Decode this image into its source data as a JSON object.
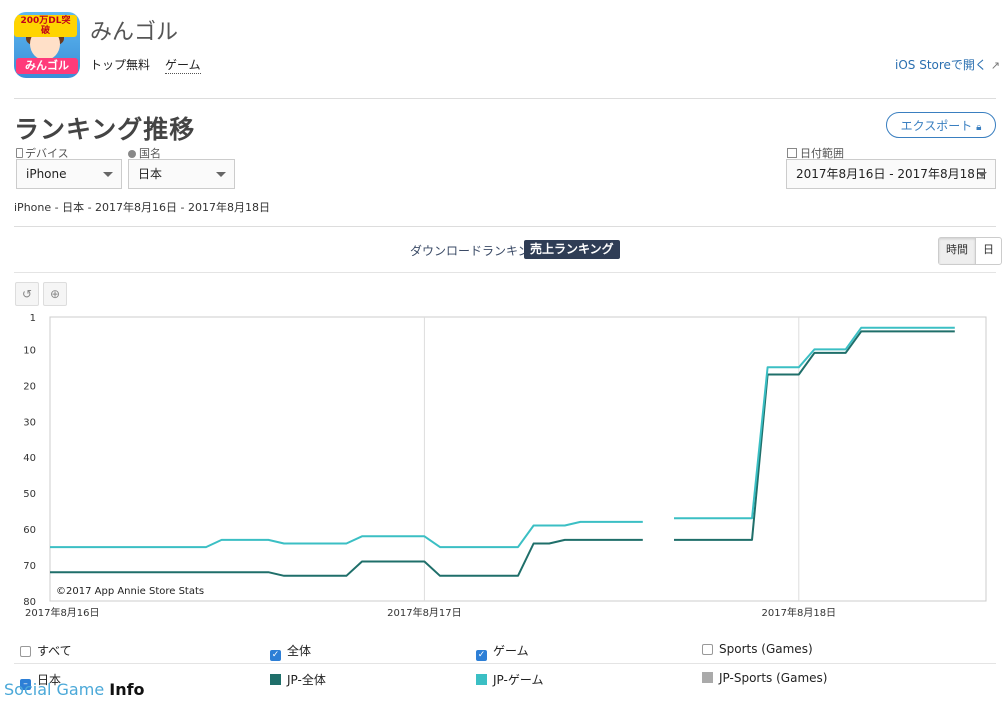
{
  "app": {
    "title": "みんゴル",
    "icon_badge": "200万DL突破",
    "icon_logo": "みんゴル",
    "category_primary": "トップ無料",
    "category_secondary": "ゲーム",
    "store_link": "iOS Storeで開く"
  },
  "section": {
    "title": "ランキング推移",
    "export_label": "エクスポート"
  },
  "filters": {
    "device_label": "デバイス",
    "device_value": "iPhone",
    "country_label": "国名",
    "country_value": "日本",
    "date_label": "日付範囲",
    "date_value": "2017年8月16日 - 2017年8月18日"
  },
  "summary": "iPhone - 日本 - 2017年8月16日 - 2017年8月18日",
  "tabs": {
    "download": "ダウンロードランキング",
    "revenue": "売上ランキング"
  },
  "granularity": {
    "hour": "時間",
    "day": "日"
  },
  "copyright": "©2017 App Annie Store Stats",
  "colors": {
    "series_all": "#1f6f6a",
    "series_game": "#3bbfc4",
    "series_sports": "#aaaaaa",
    "accent": "#2d7fd6"
  },
  "legend": {
    "filters": [
      {
        "label": "すべて",
        "checked": false
      },
      {
        "label": "全体",
        "checked": true
      },
      {
        "label": "ゲーム",
        "checked": true
      },
      {
        "label": "Sports (Games)",
        "checked": false
      }
    ],
    "country": "日本",
    "series": [
      {
        "label": "JP-全体"
      },
      {
        "label": "JP-ゲーム"
      },
      {
        "label": "JP-Sports (Games)"
      }
    ]
  },
  "watermark": {
    "text": "Social Game",
    "bold": "Info"
  },
  "chart_data": {
    "type": "line",
    "x_unit": "hours since 2017年8月16日 00:00",
    "xlim": [
      0,
      60
    ],
    "y_inverted": true,
    "ylim": [
      1,
      80
    ],
    "y_ticks": [
      1,
      10,
      20,
      30,
      40,
      50,
      60,
      70,
      80
    ],
    "x_ticks": [
      {
        "x": 0,
        "label": "2017年8月16日"
      },
      {
        "x": 24,
        "label": "2017年8月17日"
      },
      {
        "x": 48,
        "label": "2017年8月18日"
      }
    ],
    "grid": true,
    "series": [
      {
        "name": "JP-全体",
        "points": [
          [
            0,
            72
          ],
          [
            14,
            72
          ],
          [
            15,
            73
          ],
          [
            19,
            73
          ],
          [
            20,
            69
          ],
          [
            24,
            69
          ],
          [
            25,
            73
          ],
          [
            30,
            73
          ],
          [
            31,
            64
          ],
          [
            32,
            64
          ],
          [
            33,
            63
          ],
          [
            38,
            63
          ],
          null,
          [
            40,
            63
          ],
          [
            45,
            63
          ],
          [
            46,
            17
          ],
          [
            48,
            17
          ],
          [
            49,
            11
          ],
          [
            51,
            11
          ],
          [
            52,
            5
          ],
          [
            58,
            5
          ]
        ]
      },
      {
        "name": "JP-ゲーム",
        "points": [
          [
            0,
            65
          ],
          [
            10,
            65
          ],
          [
            11,
            63
          ],
          [
            14,
            63
          ],
          [
            15,
            64
          ],
          [
            19,
            64
          ],
          [
            20,
            62
          ],
          [
            24,
            62
          ],
          [
            25,
            65
          ],
          [
            30,
            65
          ],
          [
            31,
            59
          ],
          [
            33,
            59
          ],
          [
            34,
            58
          ],
          [
            38,
            58
          ],
          null,
          [
            40,
            57
          ],
          [
            45,
            57
          ],
          [
            46,
            15
          ],
          [
            48,
            15
          ],
          [
            49,
            10
          ],
          [
            51,
            10
          ],
          [
            52,
            4
          ],
          [
            58,
            4
          ]
        ]
      }
    ]
  }
}
